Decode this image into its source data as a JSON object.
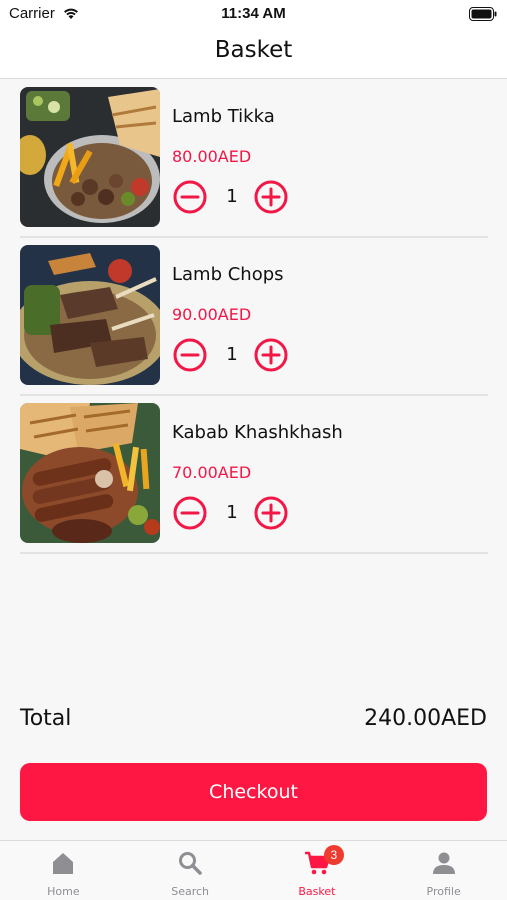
{
  "status_bar": {
    "carrier": "Carrier",
    "time": "11:34 AM"
  },
  "header": {
    "title": "Basket"
  },
  "items": [
    {
      "name": "Lamb Tikka",
      "price": "80.00AED",
      "quantity": "1",
      "image": "lamb-tikka-image"
    },
    {
      "name": "Lamb Chops",
      "price": "90.00AED",
      "quantity": "1",
      "image": "lamb-chops-image"
    },
    {
      "name": "Kabab Khashkhash",
      "price": "70.00AED",
      "quantity": "1",
      "image": "kabab-khashkhash-image"
    }
  ],
  "summary": {
    "total_label": "Total",
    "total_value": "240.00AED"
  },
  "checkout": {
    "label": "Checkout"
  },
  "tabs": [
    {
      "label": "Home",
      "icon": "home-icon"
    },
    {
      "label": "Search",
      "icon": "search-icon"
    },
    {
      "label": "Basket",
      "icon": "cart-icon",
      "badge": "3",
      "active": true
    },
    {
      "label": "Profile",
      "icon": "person-icon"
    }
  ],
  "colors": {
    "accent": "#ff1744",
    "price": "#f21746",
    "badge": "#ef3b2f",
    "tab_inactive": "#8e8e93"
  }
}
